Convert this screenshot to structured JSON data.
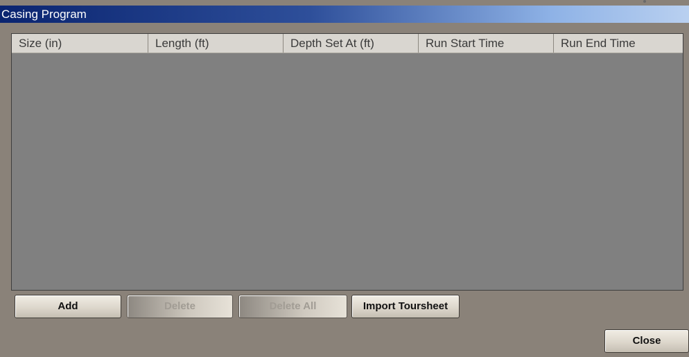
{
  "window": {
    "title": "Casing Program"
  },
  "grid": {
    "columns": [
      "Size (in)",
      "Length (ft)",
      "Depth Set At (ft)",
      "Run Start Time",
      "Run End Time"
    ],
    "rows": []
  },
  "buttons": {
    "add": "Add",
    "delete": "Delete",
    "delete_all": "Delete All",
    "import_toursheet": "Import Toursheet",
    "close": "Close"
  },
  "colors": {
    "titlebar_start": "#0a2470",
    "titlebar_end": "#b9d0f0",
    "window_background": "#8a8279",
    "grid_background": "#808080",
    "header_background": "#d9d6d0"
  }
}
